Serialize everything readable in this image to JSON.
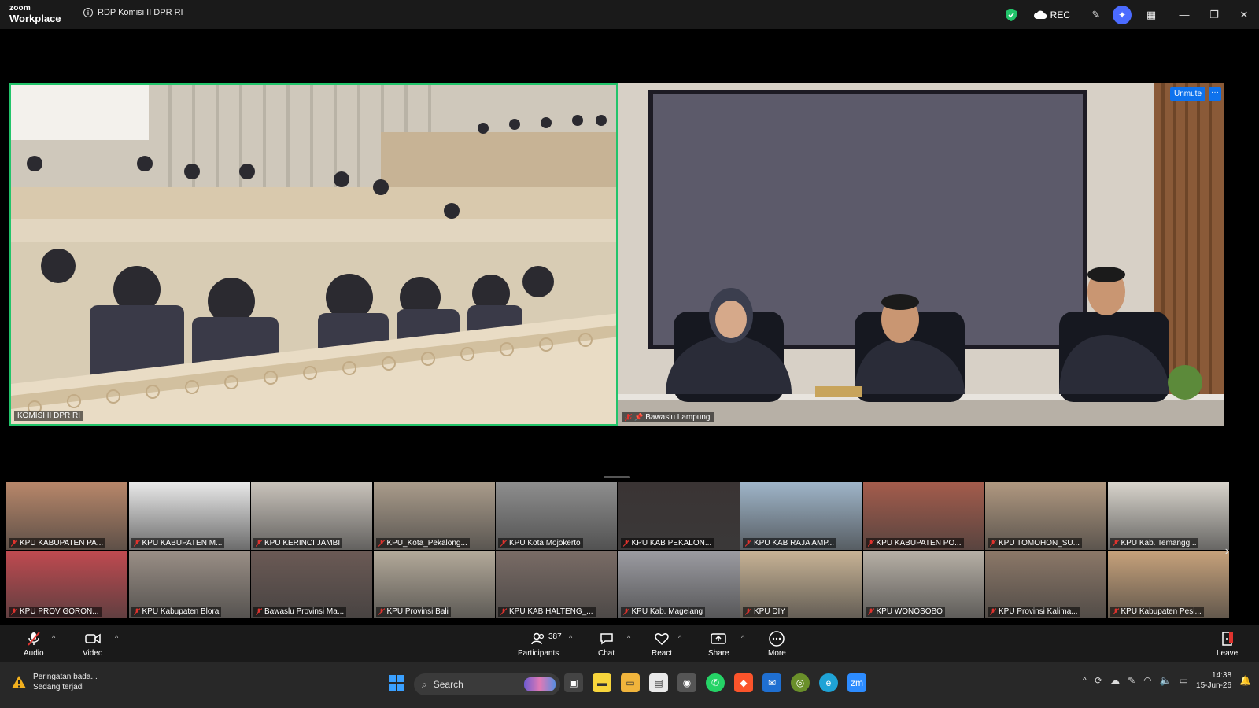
{
  "app": {
    "logo_line1": "zoom",
    "logo_line2": "Workplace",
    "meeting_title": "RDP Komisi II DPR RI",
    "rec_label": "REC"
  },
  "colors": {
    "active_speaker_border": "#22c46a",
    "accent": "#0e72ed",
    "security_shield": "#22c46a",
    "mic_muted": "#e0332e"
  },
  "main_tiles": [
    {
      "name": "KOMISI  II DPR RI",
      "muted": false
    },
    {
      "name": "Bawaslu Lampung",
      "muted": true,
      "pinned": true,
      "unmute_label": "Unmute",
      "more_label": "···"
    }
  ],
  "gallery": [
    {
      "name": "KPU KABUPATEN PA...",
      "color": "#b8876a"
    },
    {
      "name": "KPU KABUPATEN M...",
      "color": "#e9e9e9"
    },
    {
      "name": "KPU KERINCI JAMBI",
      "color": "#c9c3bb"
    },
    {
      "name": "KPU_Kota_Pekalong...",
      "color": "#aa9c8b"
    },
    {
      "name": "KPU Kota Mojokerto",
      "color": "#8e8e8e"
    },
    {
      "name": "KPU KAB PEKALON...",
      "color": "#3a3434"
    },
    {
      "name": "KPU KAB RAJA AMP...",
      "color": "#9fb5c9"
    },
    {
      "name": "KPU KABUPATEN PO...",
      "color": "#a45c4c"
    },
    {
      "name": "KPU TOMOHON_SU...",
      "color": "#b09880"
    },
    {
      "name": "KPU Kab. Temangg...",
      "color": "#d8d4cc"
    },
    {
      "name": "KPU PROV GORON...",
      "color": "#c04a50"
    },
    {
      "name": "KPU Kabupaten Blora",
      "color": "#9a8f86"
    },
    {
      "name": "Bawaslu Provinsi Ma...",
      "color": "#6b5a55"
    },
    {
      "name": "KPU Provinsi Bali",
      "color": "#b4aa9a"
    },
    {
      "name": "KPU KAB HALTENG_...",
      "color": "#7a6c66"
    },
    {
      "name": "KPU Kab. Magelang",
      "color": "#9c9ca2"
    },
    {
      "name": "KPU DIY",
      "color": "#c9b496"
    },
    {
      "name": "KPU WONOSOBO",
      "color": "#b7b0a6"
    },
    {
      "name": "KPU Provinsi Kalima...",
      "color": "#8c7868"
    },
    {
      "name": "KPU Kabupaten Pesi...",
      "color": "#c7a27b"
    }
  ],
  "toolbar": {
    "audio": "Audio",
    "video": "Video",
    "participants": "Participants",
    "participants_count": "387",
    "chat": "Chat",
    "react": "React",
    "share": "Share",
    "more": "More",
    "leave": "Leave"
  },
  "taskbar": {
    "weather_line1": "Peringatan bada...",
    "weather_line2": "Sedang terjadi",
    "search_placeholder": "Search",
    "time": "14:38",
    "date": "15-Jun-26"
  }
}
